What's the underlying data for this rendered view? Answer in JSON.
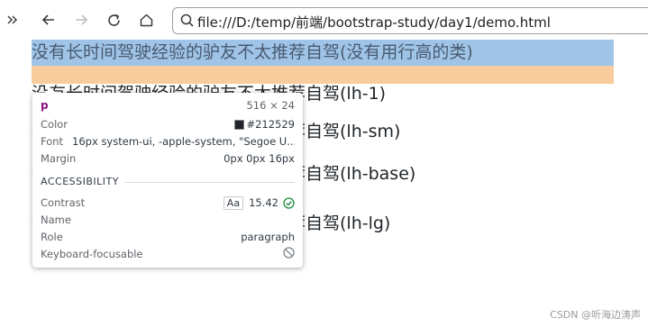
{
  "browser": {
    "url": "file:///D:/temp/前端/bootstrap-study/day1/demo.html",
    "icons": [
      "sidebar-toggle-icon",
      "back-arrow-icon",
      "forward-arrow-icon",
      "reload-icon",
      "home-icon",
      "search-icon"
    ]
  },
  "page": {
    "lines": [
      "没有长时间驾驶经验的驴友不太推荐自驾(没有用行高的类)",
      "没有长时间驾驶经验的驴友不太推荐自驾(lh-1)",
      "没有长时间驾驶经验的驴友不太推荐自驾(lh-sm)",
      "没有长时间驾驶经验的驴友不太推荐自驾(lh-base)",
      "没有长时间驾驶经验的驴友不太推荐自驾(lh-lg)"
    ],
    "highlight_colors": {
      "content": "#9fc4e7",
      "margin": "#f9cc9d"
    }
  },
  "tooltip": {
    "tag": "p",
    "size": "516 × 24",
    "rows": [
      {
        "key": "Color",
        "value": "#212529"
      },
      {
        "key": "Font",
        "value": "16px system-ui, -apple-system, \"Segoe U..."
      },
      {
        "key": "Margin",
        "value": "0px 0px 16px"
      }
    ],
    "accessibility_title": "ACCESSIBILITY",
    "contrast": {
      "label": "Contrast",
      "badge": "Aa",
      "value": "15.42"
    },
    "name_label": "Name",
    "role": {
      "label": "Role",
      "value": "paragraph"
    },
    "keyboard": {
      "label": "Keyboard-focusable"
    },
    "colors": {
      "text_color": "#212529",
      "pass": "#1e8e3e",
      "tag": "#881280"
    }
  },
  "watermark": "CSDN @听海边涛声"
}
